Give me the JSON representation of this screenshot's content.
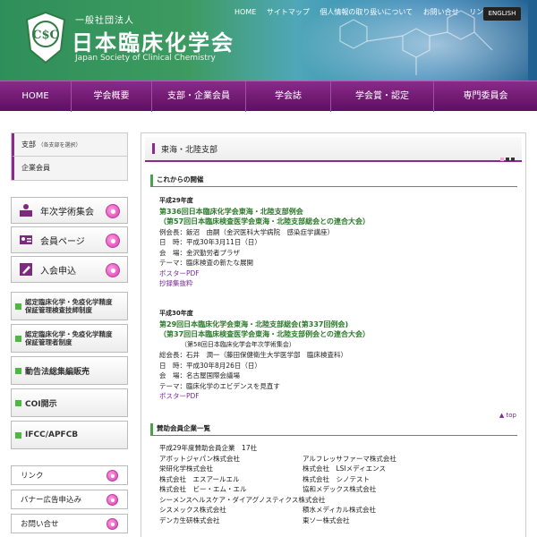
{
  "header": {
    "org_sub": "一般社団法人",
    "org_title": "日本臨床化学会",
    "org_en": "Japan Society of Clinical Chemistry",
    "links": [
      "HOME",
      "サイトマップ",
      "個人情報の取り扱いについて",
      "お問い合せ",
      "リンク"
    ],
    "english": "ENGLISH"
  },
  "nav": [
    "HOME",
    "学会概要",
    "支部・企業会員",
    "学会誌",
    "学会賞・認定",
    "専門委員会"
  ],
  "sidebar": {
    "sub": [
      "支部",
      "（各支部を選択）",
      "企業会員"
    ],
    "big_buttons": [
      "年次学術集会",
      "会員ページ",
      "入会申込"
    ],
    "green_buttons": [
      [
        "認定臨床化学・免疫化学精度",
        "保証管理検査技師制度"
      ],
      [
        "認定臨床化学・免疫化学精度",
        "保証管理者制度"
      ],
      [
        "動告法総集編販売"
      ],
      [
        "COI開示"
      ],
      [
        "IFCC/APFCB"
      ]
    ],
    "bottom_buttons": [
      "リンク",
      "バナー広告申込み",
      "お問い合せ"
    ]
  },
  "main": {
    "title": "東海・北陸支部",
    "section1": "これからの開催",
    "event1": {
      "year": "平成29年度",
      "title1": "第336回日本臨床化学会東海・北陸支部例会",
      "title2": "（第57回日本臨床検査医学会東海・北陸支部総会との連合大会）",
      "l1": "例会長：飯沼　由嗣（金沢医科大学病院　感染症学講座）",
      "l2": "日　時：平成30年3月11日（日）",
      "l3": "会　場：金沢勤労者プラザ",
      "l4": "テーマ：臨床検査の新たな展開",
      "poster": "ポスターPDF",
      "abstract": "抄録集抜粋"
    },
    "event2": {
      "year": "平成30年度",
      "title1": "第29回日本臨床化学会東海・北陸支部総会(第337回例会)",
      "title2": "（第37回日本臨床検査医学会東海・北陸支部例会との連合大会）",
      "sub": "（第58回日本臨床化学会年次学術集会）",
      "l1": "総会長：石井　潤一（藤田保健衛生大学医学部　臨床検査科）",
      "l2": "日　時：平成30年8月26日（日）",
      "l3": "会　場：名古屋国際会議場",
      "l4": "テーマ：臨床化学のエビデンスを見直す",
      "poster": "ポスターPDF"
    },
    "top_link": "▲ top",
    "section2": "賛助会員企業一覧",
    "members_head": "平成29年度賛助会員企業　17社",
    "members": [
      [
        "アボットジャパン株式会社",
        "アルフレッサファーマ株式会社"
      ],
      [
        "栄研化学株式会社",
        "株式会社　LSIメディエンス"
      ],
      [
        "株式会社　エスアールエル",
        "株式会社　シノテスト"
      ],
      [
        "株式会社　ビー・エム・エル",
        "協和メデックス株式会社"
      ],
      [
        "シーメンスヘルスケア・ダイアグノスティクス株式会社",
        ""
      ],
      [
        "シスメックス株式会社",
        "積水メディカル株式会社"
      ],
      [
        "デンカ生研株式会社",
        "東ソー株式会社"
      ]
    ]
  }
}
